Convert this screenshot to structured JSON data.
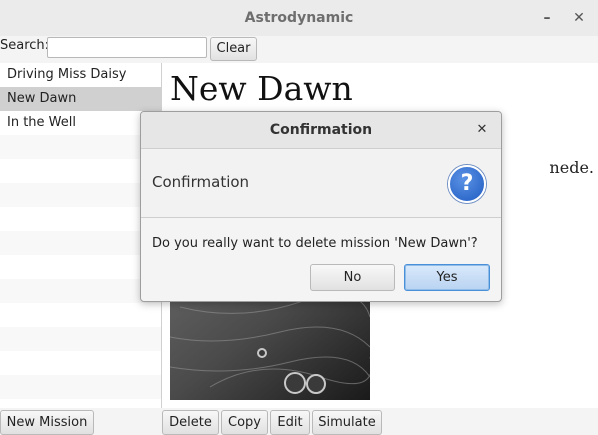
{
  "window": {
    "title": "Astrodynamic",
    "minimize_icon": "minimize-icon",
    "close_icon": "close-icon"
  },
  "search": {
    "label": "Search:",
    "value": "",
    "placeholder": "",
    "clear_label": "Clear"
  },
  "missions": {
    "items": [
      {
        "label": "Driving Miss Daisy"
      },
      {
        "label": "New Dawn"
      },
      {
        "label": "In the Well"
      }
    ],
    "selected": "New Dawn"
  },
  "detail": {
    "title": "New Dawn",
    "description_visible": "nede.",
    "image_name": "moon-surface-image"
  },
  "bottom": {
    "new_mission": "New Mission",
    "delete": "Delete",
    "copy": "Copy",
    "edit": "Edit",
    "simulate": "Simulate"
  },
  "dialog": {
    "title": "Confirmation",
    "header": "Confirmation",
    "icon": "question-icon",
    "icon_glyph": "?",
    "message": "Do you really want to delete mission 'New Dawn'?",
    "no": "No",
    "yes": "Yes"
  },
  "colors": {
    "selection": "#d0d0d0",
    "default_button_border": "#4a90d9",
    "question_icon": "#1f5cc2"
  }
}
